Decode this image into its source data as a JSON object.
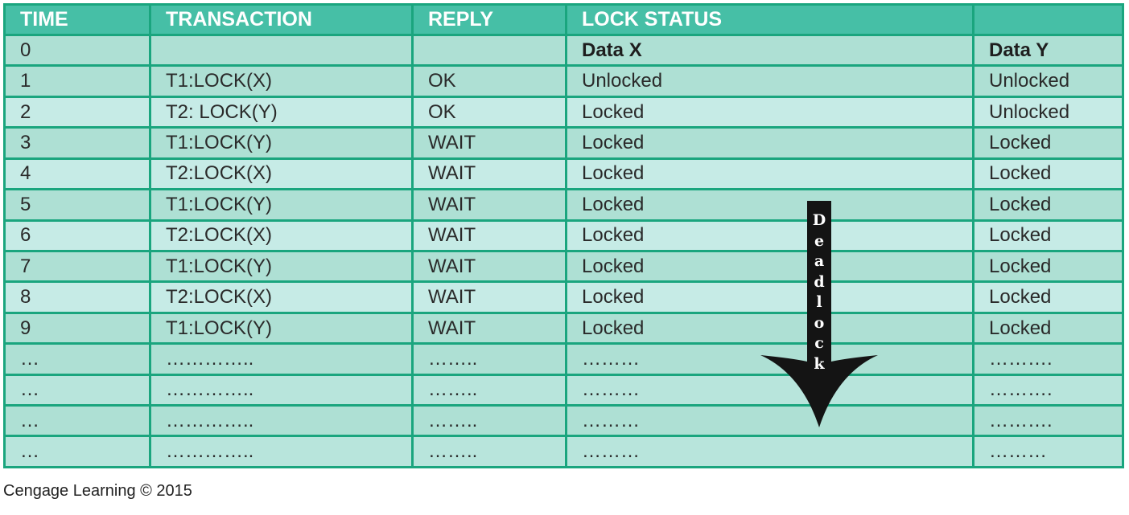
{
  "table": {
    "headers": [
      "TIME",
      "TRANSACTION",
      "REPLY",
      "LOCK STATUS",
      ""
    ],
    "subheader_row": {
      "time": "0",
      "transaction": "",
      "reply": "",
      "data_x": "Data X",
      "data_y": "Data Y"
    },
    "rows": [
      {
        "time": "1",
        "transaction": "T1:LOCK(X)",
        "reply": "OK",
        "data_x": "Unlocked",
        "data_y": "Unlocked"
      },
      {
        "time": "2",
        "transaction": "T2: LOCK(Y)",
        "reply": "OK",
        "data_x": "Locked",
        "data_y": "Unlocked"
      },
      {
        "time": "3",
        "transaction": "T1:LOCK(Y)",
        "reply": "WAIT",
        "data_x": "Locked",
        "data_y": "Locked"
      },
      {
        "time": "4",
        "transaction": "T2:LOCK(X)",
        "reply": "WAIT",
        "data_x": "Locked",
        "data_y": "Locked"
      },
      {
        "time": "5",
        "transaction": "T1:LOCK(Y)",
        "reply": "WAIT",
        "data_x": "Locked",
        "data_y": "Locked"
      },
      {
        "time": "6",
        "transaction": "T2:LOCK(X)",
        "reply": "WAIT",
        "data_x": "Locked",
        "data_y": "Locked"
      },
      {
        "time": "7",
        "transaction": "T1:LOCK(Y)",
        "reply": "WAIT",
        "data_x": "Locked",
        "data_y": "Locked"
      },
      {
        "time": "8",
        "transaction": "T2:LOCK(X)",
        "reply": "WAIT",
        "data_x": "Locked",
        "data_y": "Locked"
      },
      {
        "time": "9",
        "transaction": "T1:LOCK(Y)",
        "reply": "WAIT",
        "data_x": "Locked",
        "data_y": "Locked"
      }
    ],
    "ellipsis_rows": [
      {
        "time": "…",
        "transaction": "…………..",
        "reply": "……..",
        "data_x": "………",
        "data_y": "………."
      },
      {
        "time": "…",
        "transaction": "…………..",
        "reply": "……..",
        "data_x": "………",
        "data_y": "………."
      },
      {
        "time": "…",
        "transaction": "…………..",
        "reply": "……..",
        "data_x": "………",
        "data_y": "………."
      },
      {
        "time": "…",
        "transaction": "…………..",
        "reply": "……..",
        "data_x": "………",
        "data_y": "………"
      }
    ]
  },
  "deadlock_arrow": {
    "letters": [
      "D",
      "e",
      "a",
      "d",
      "l",
      "o",
      "c",
      "k"
    ],
    "icon": "down-arrow-icon",
    "color": "#141414"
  },
  "credit": "Cengage Learning © 2015",
  "colors": {
    "border": "#1aa57e",
    "header_bg": "#46bfa6",
    "row_odd": "#aee0d4",
    "row_even": "#c6ebe6"
  }
}
